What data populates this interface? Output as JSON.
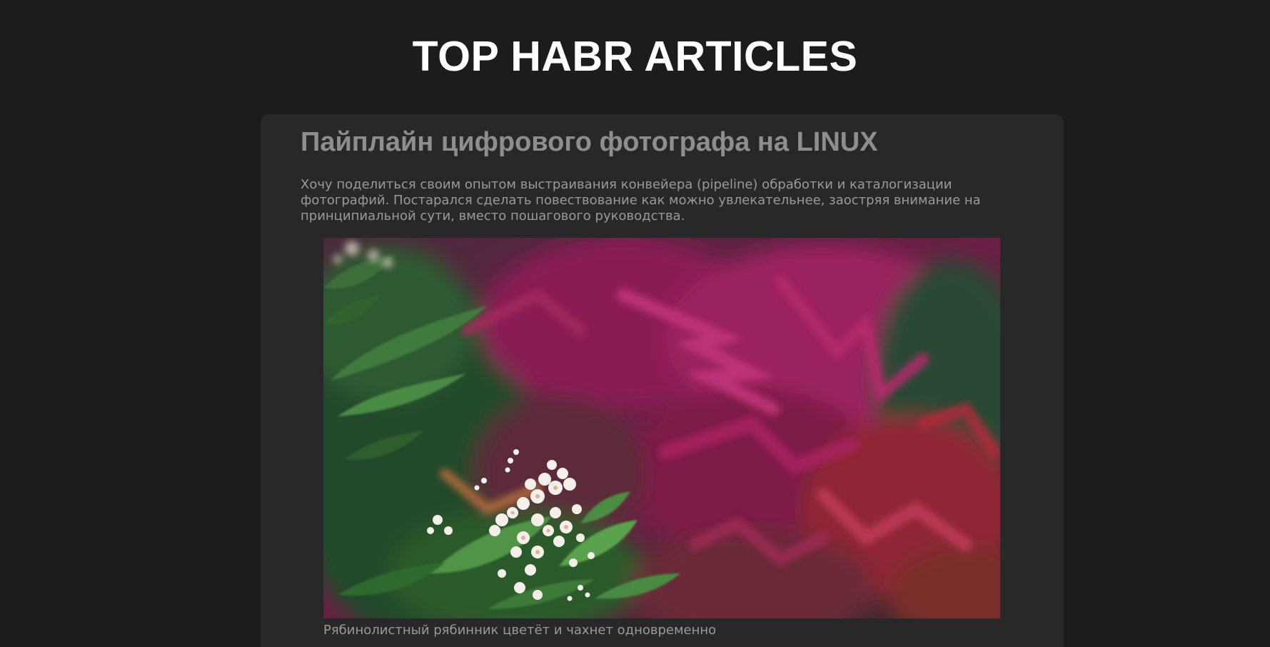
{
  "header": {
    "title": "TOP HABR ARTICLES"
  },
  "article": {
    "title": "Пайплайн цифрового фотографа на LINUX",
    "summary": "Хочу поделиться своим опытом выстраивания конвейера (pipeline) обработки и каталогизации фотографий. Постарался сделать повествование как можно увлекательнее, заостряя внимание на принципиальной сути, вместо пошагового руководства.",
    "image": {
      "caption": "Рябинолистный рябинник цветёт и чахнет одновременно"
    }
  },
  "colors": {
    "page_background": "#1c1c1c",
    "card_background": "#282828",
    "title_text": "#ffffff",
    "article_title_text": "#8e8e8e",
    "body_text": "#9a9a9a"
  }
}
